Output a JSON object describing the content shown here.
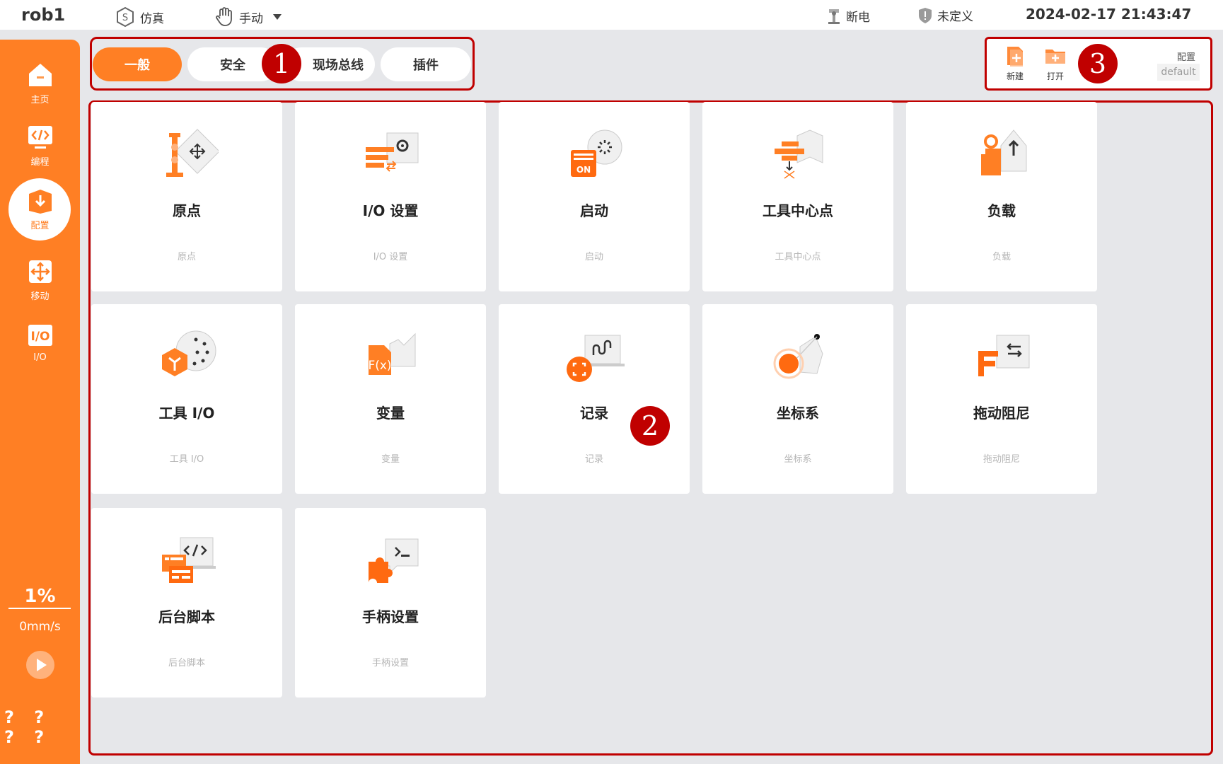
{
  "topbar": {
    "robot_name": "rob1",
    "mode_sim": "仿真",
    "mode_manual": "手动",
    "power_status": "断电",
    "safety_status": "未定义",
    "datetime": "2024-02-17 21:43:47"
  },
  "sidebar": {
    "items": [
      {
        "label": "主页",
        "icon": "home-icon"
      },
      {
        "label": "编程",
        "icon": "code-icon"
      },
      {
        "label": "配置",
        "icon": "config-icon"
      },
      {
        "label": "移动",
        "icon": "move-icon"
      },
      {
        "label": "I/O",
        "icon": "io-icon"
      }
    ],
    "speed_percent": "1%",
    "speed_mms": "0mm/s",
    "help_marks": "? ? ? ?"
  },
  "tabs": [
    {
      "label": "一般",
      "active": true
    },
    {
      "label": "安全",
      "active": false
    },
    {
      "label": "现场总线",
      "active": false
    },
    {
      "label": "插件",
      "active": false
    }
  ],
  "config": {
    "new_label": "新建",
    "open_label": "打开",
    "label": "配置",
    "value": "default"
  },
  "markers": [
    "1",
    "2",
    "3"
  ],
  "cards": [
    {
      "title": "原点",
      "subtitle": "原点",
      "icon": "origin-icon"
    },
    {
      "title": "I/O 设置",
      "subtitle": "I/O 设置",
      "icon": "io-settings-icon"
    },
    {
      "title": "启动",
      "subtitle": "启动",
      "icon": "startup-icon"
    },
    {
      "title": "工具中心点",
      "subtitle": "工具中心点",
      "icon": "tcp-icon"
    },
    {
      "title": "负载",
      "subtitle": "负载",
      "icon": "payload-icon"
    },
    {
      "title": "工具 I/O",
      "subtitle": "工具 I/O",
      "icon": "tool-io-icon"
    },
    {
      "title": "变量",
      "subtitle": "变量",
      "icon": "variable-icon"
    },
    {
      "title": "记录",
      "subtitle": "记录",
      "icon": "record-icon"
    },
    {
      "title": "坐标系",
      "subtitle": "坐标系",
      "icon": "frame-icon"
    },
    {
      "title": "拖动阻尼",
      "subtitle": "拖动阻尼",
      "icon": "drag-damping-icon"
    },
    {
      "title": "后台脚本",
      "subtitle": "后台脚本",
      "icon": "background-script-icon"
    },
    {
      "title": "手柄设置",
      "subtitle": "手柄设置",
      "icon": "handle-settings-icon"
    }
  ],
  "colors": {
    "accent": "#ff7f24",
    "annotation": "#c00000",
    "background": "#e6e7ea"
  }
}
